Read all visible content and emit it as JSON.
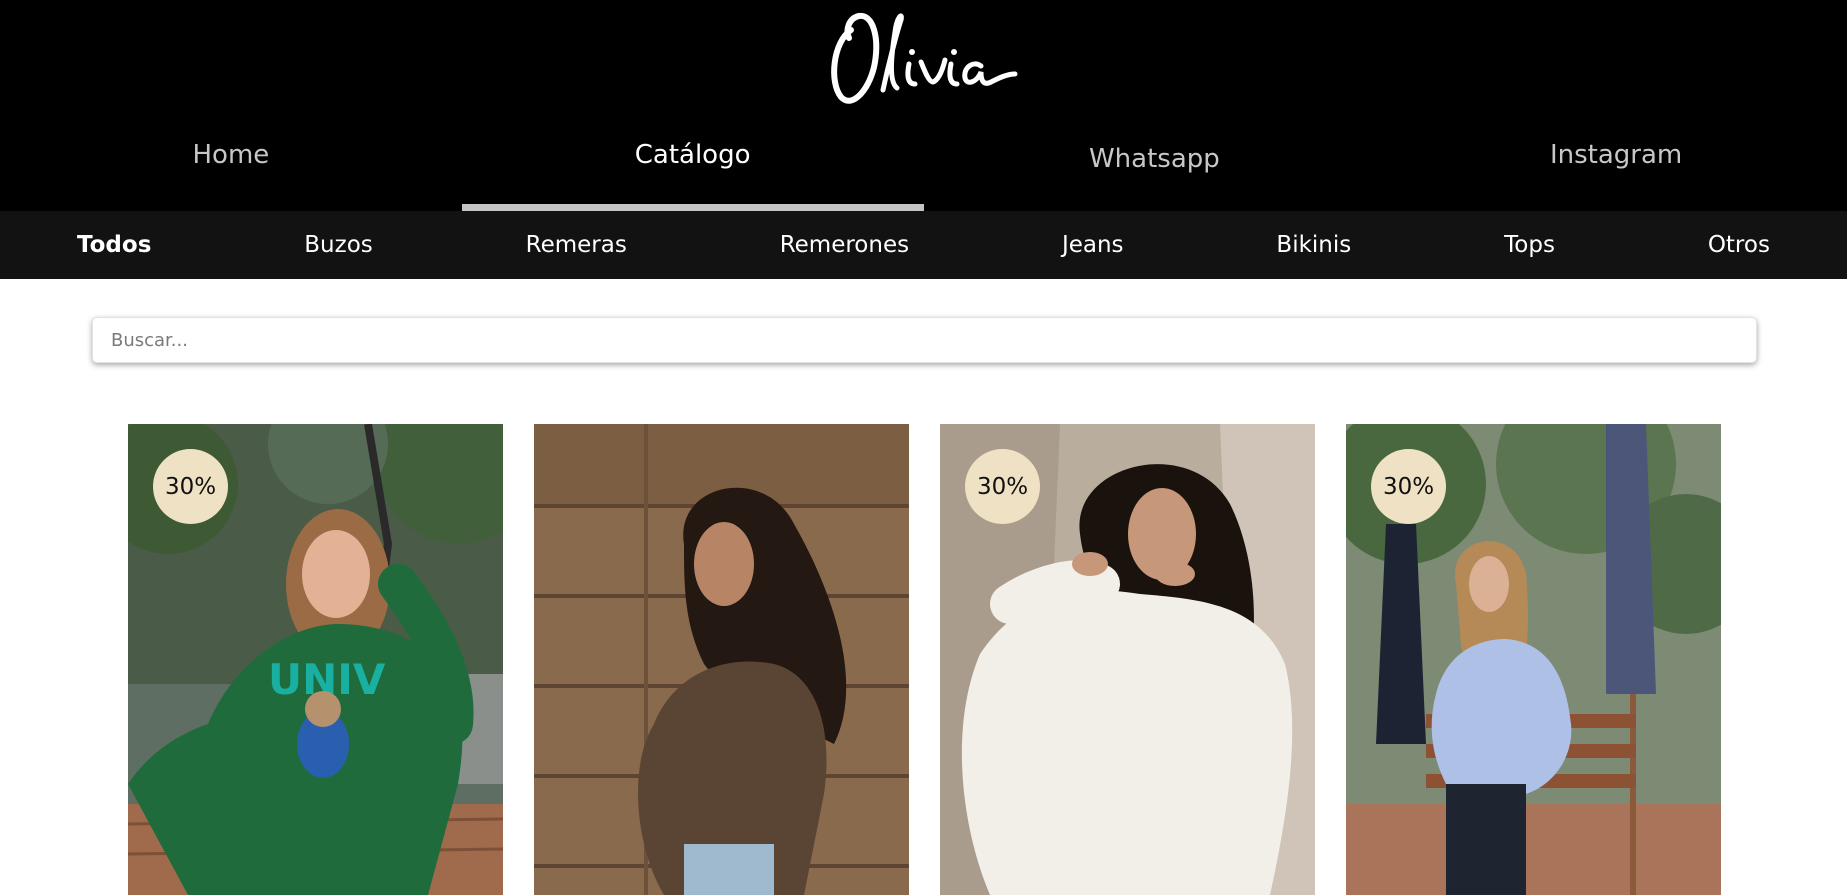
{
  "brand": {
    "logo_text": "Olivia"
  },
  "main_nav": [
    {
      "label": "Home"
    },
    {
      "label": "Catálogo"
    },
    {
      "label": "Whatsapp"
    },
    {
      "label": "Instagram"
    }
  ],
  "categories": [
    {
      "label": "Todos"
    },
    {
      "label": "Buzos"
    },
    {
      "label": "Remeras"
    },
    {
      "label": "Remerones"
    },
    {
      "label": "Jeans"
    },
    {
      "label": "Bikinis"
    },
    {
      "label": "Tops"
    },
    {
      "label": "Otros"
    }
  ],
  "search": {
    "placeholder": "Buscar..."
  },
  "products": [
    {
      "discount": "30%",
      "image": "green-hoodie-photo"
    },
    {
      "discount": "",
      "image": "brown-sweatshirt-photo"
    },
    {
      "discount": "30%",
      "image": "white-fleece-photo"
    },
    {
      "discount": "30%",
      "image": "blue-hoodie-photo"
    }
  ],
  "colors": {
    "header_bg": "#000000",
    "category_bar_bg": "#121212",
    "active_underline": "#c4c4c4",
    "badge_bg": "#efe2c4"
  }
}
